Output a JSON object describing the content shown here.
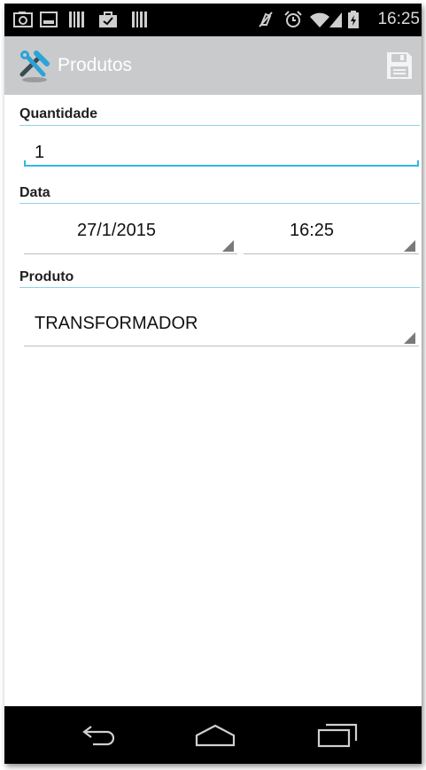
{
  "status_bar": {
    "time": "16:25",
    "left_icons": [
      "camera-icon",
      "image-icon",
      "barcode-icon",
      "shopping-bag-icon",
      "barcode-icon"
    ],
    "right_icons": [
      "mute-icon",
      "alarm-icon",
      "wifi-icon",
      "signal-icon",
      "battery-icon"
    ]
  },
  "action_bar": {
    "title": "Produtos",
    "app_icon": "tools-icon",
    "save_icon": "save-icon",
    "background": "#c9cacb"
  },
  "form": {
    "quantity_label": "Quantidade",
    "quantity_value": "1",
    "date_label": "Data",
    "date_value": "27/1/2015",
    "time_value": "16:25",
    "product_label": "Produto",
    "product_value": "TRANSFORMADOR"
  },
  "nav_bar": {
    "back_icon": "back-icon",
    "home_icon": "home-icon",
    "recents_icon": "recent-apps-icon"
  },
  "colors": {
    "accent": "#33b5e5",
    "divider": "#8fd0ec"
  }
}
